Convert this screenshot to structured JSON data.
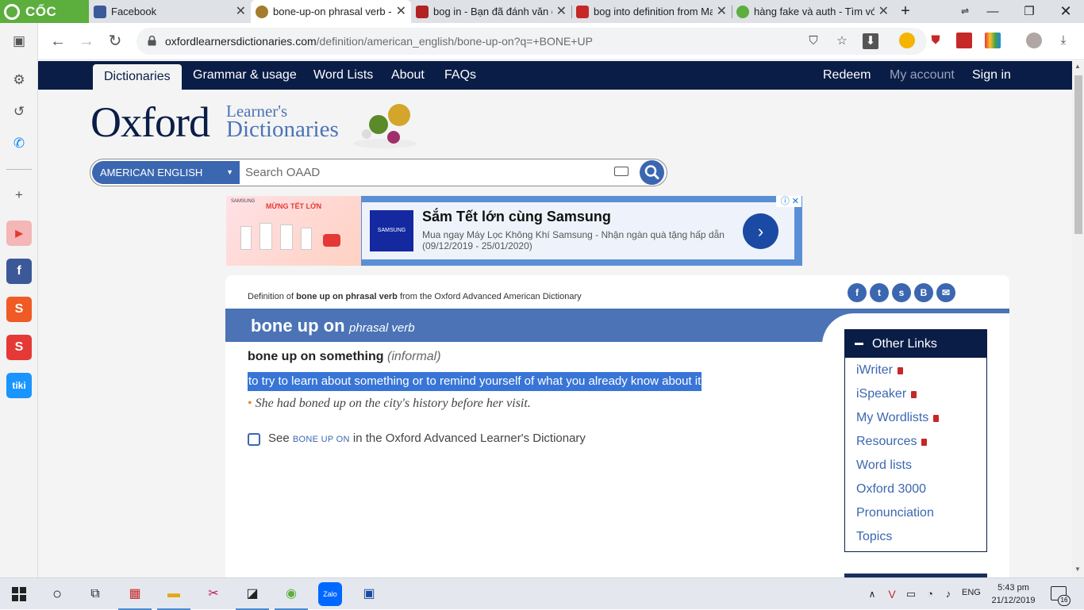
{
  "browser": {
    "brand": "CỐC CỐC",
    "tabs": [
      {
        "title": "Facebook",
        "favicon_color": "#3b5998"
      },
      {
        "title": "bone-up-on phrasal verb - (",
        "favicon_color": "#a57c2c"
      },
      {
        "title": "bog in - Bạn đã đánh văn d",
        "favicon_color": "#b22222"
      },
      {
        "title": "bog into definition from Ma",
        "favicon_color": "#c62828"
      },
      {
        "title": "hàng fake và auth - Tìm với",
        "favicon_color": "#5cae3d"
      }
    ],
    "new_tab": "+",
    "url_host": "oxfordlearnersdictionaries.com",
    "url_path": "/definition/american_english/bone-up-on?q=+BONE+UP"
  },
  "site": {
    "nav": {
      "dictionaries": "Dictionaries",
      "grammar": "Grammar & usage",
      "word_lists": "Word Lists",
      "about": "About",
      "faqs": "FAQs",
      "redeem": "Redeem",
      "my_account": "My account",
      "sign_in": "Sign in"
    },
    "logo": {
      "oxford": "Oxford",
      "learners": "Learner's",
      "dictionaries": "Dictionaries"
    },
    "search": {
      "dictionary": "AMERICAN ENGLISH",
      "placeholder": "Search OAAD"
    },
    "ad": {
      "banner_title": "MỪNG TẾT LỚN",
      "banner_sub": "SAMSUNG",
      "logo": "SAMSUNG",
      "title": "Sắm Tết lớn cùng Samsung",
      "description": "Mua ngay Máy Lọc Không Khí Samsung - Nhận ngàn quà tặng hấp dẫn (09/12/2019 - 25/01/2020)"
    },
    "entry": {
      "source_prefix": "Definition of ",
      "source_bold": "bone up on phrasal verb",
      "source_suffix": " from the Oxford Advanced American Dictionary",
      "headword": "bone up on",
      "pos": "phrasal verb",
      "phrase": "bone up on something",
      "label": "(informal)",
      "definition": "to try to learn about something or to remind yourself of what you already know about it",
      "example": "She had boned up on the city's history before her visit.",
      "see_prefix": "See ",
      "see_word": "BONE UP ON",
      "see_suffix": " in the Oxford Advanced Learner's Dictionary"
    },
    "other_links": {
      "title": "Other Links",
      "items": [
        "iWriter",
        "iSpeaker",
        "My Wordlists",
        "Resources",
        "Word lists",
        "Oxford 3000",
        "Pronunciation",
        "Topics"
      ]
    }
  },
  "taskbar": {
    "lang": "ENG",
    "time": "5:43 pm",
    "date": "21/12/2019",
    "notifications": "16"
  }
}
